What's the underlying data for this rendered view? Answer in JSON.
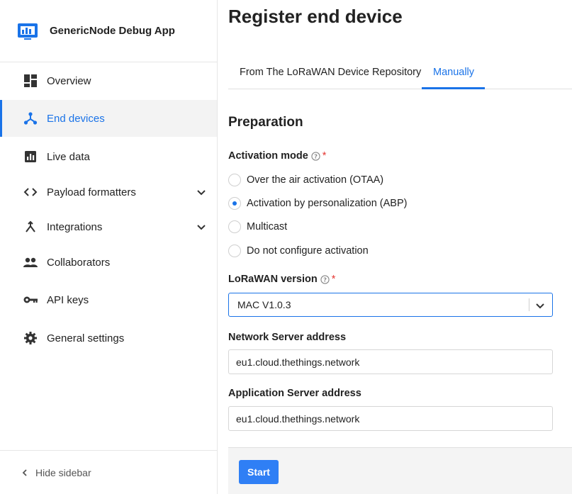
{
  "app": {
    "name": "GenericNode Debug App"
  },
  "sidebar": {
    "items": [
      {
        "label": "Overview",
        "icon": "dashboard-icon",
        "active": false
      },
      {
        "label": "End devices",
        "icon": "device-hub-icon",
        "active": true
      },
      {
        "label": "Live data",
        "icon": "bar-chart-icon",
        "active": false
      },
      {
        "label": "Payload formatters",
        "icon": "code-icon",
        "active": false,
        "expandable": true
      },
      {
        "label": "Integrations",
        "icon": "merge-icon",
        "active": false,
        "expandable": true
      },
      {
        "label": "Collaborators",
        "icon": "people-icon",
        "active": false
      },
      {
        "label": "API keys",
        "icon": "key-icon",
        "active": false
      },
      {
        "label": "General settings",
        "icon": "gear-icon",
        "active": false
      }
    ],
    "footer_label": "Hide sidebar"
  },
  "main": {
    "title": "Register end device",
    "tabs": [
      {
        "label": "From The LoRaWAN Device Repository",
        "active": false
      },
      {
        "label": "Manually",
        "active": true
      }
    ],
    "section_title": "Preparation",
    "activation": {
      "label": "Activation mode",
      "required_mark": "*",
      "options": [
        {
          "label": "Over the air activation (OTAA)",
          "checked": false
        },
        {
          "label": "Activation by personalization (ABP)",
          "checked": true
        },
        {
          "label": "Multicast",
          "checked": false
        },
        {
          "label": "Do not configure activation",
          "checked": false
        }
      ]
    },
    "lorawan": {
      "label": "LoRaWAN version",
      "required_mark": "*",
      "value": "MAC V1.0.3"
    },
    "network_server": {
      "label": "Network Server address",
      "value": "eu1.cloud.thethings.network"
    },
    "application_server": {
      "label": "Application Server address",
      "value": "eu1.cloud.thethings.network"
    },
    "submit_label": "Start"
  },
  "colors": {
    "accent": "#1a73e8",
    "button": "#2f7ff5",
    "required": "#e53935"
  }
}
